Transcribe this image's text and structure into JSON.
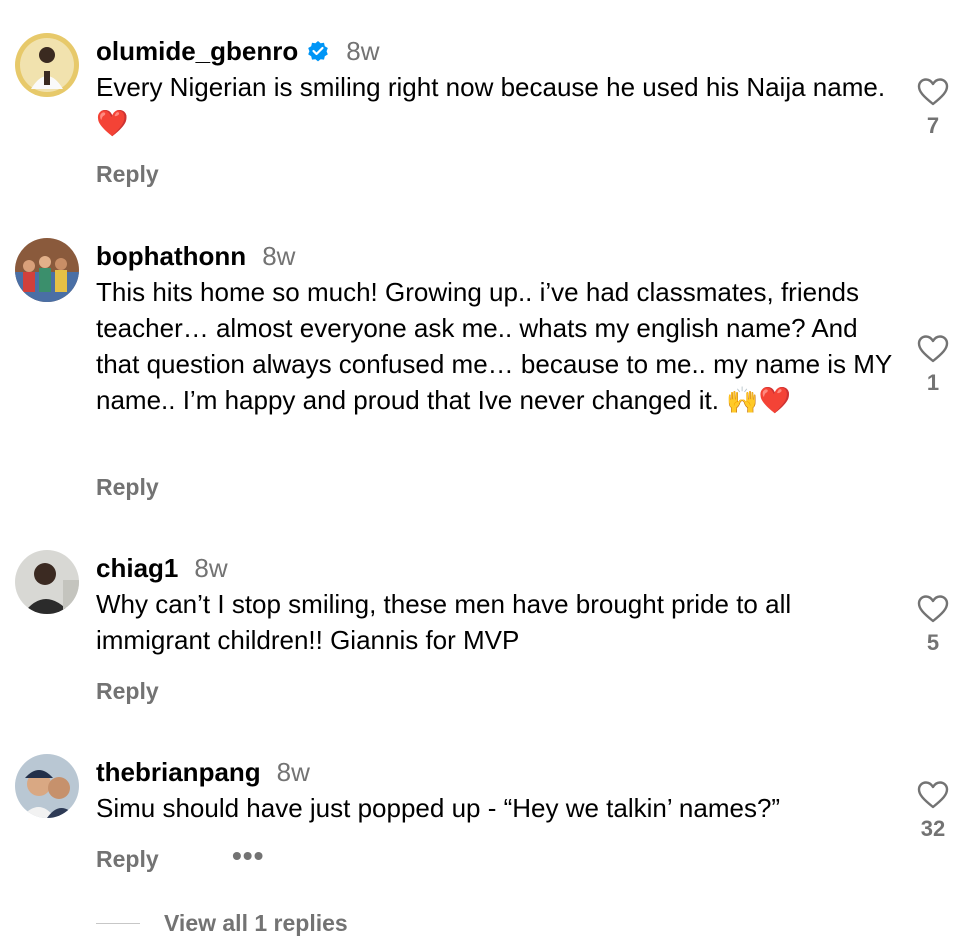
{
  "comments": [
    {
      "username": "olumide_gbenro",
      "verified": true,
      "time": "8w",
      "text": "Every Nigerian is smiling right now because he used his Naija name. ",
      "emoji": "❤️",
      "likes": "7",
      "reply_label": "Reply"
    },
    {
      "username": "bophathonn",
      "verified": false,
      "time": "8w",
      "text": "This hits home so much! Growing up.. i’ve had classmates, friends teacher… almost everyone ask me.. whats my english name? And that question always confused me… because to me.. my name is MY name.. I’m happy and proud that Ive never changed it. ",
      "emoji": "🙌❤️",
      "likes": "1",
      "reply_label": "Reply"
    },
    {
      "username": "chiag1",
      "verified": false,
      "time": "8w",
      "text": "Why can’t I stop smiling, these men have brought pride to all immigrant children!! Giannis for MVP",
      "emoji": "",
      "likes": "5",
      "reply_label": "Reply"
    },
    {
      "username": "thebrianpang",
      "verified": false,
      "time": "8w",
      "text": "Simu should have just popped up - “Hey we talkin’ names?”",
      "emoji": "",
      "likes": "32",
      "reply_label": "Reply"
    }
  ],
  "more_options": "•••",
  "view_replies": "View all 1 replies",
  "icons": {
    "verified": "verified-badge-icon",
    "like": "heart-outline-icon",
    "more": "more-options-icon"
  },
  "colors": {
    "text": "#000000",
    "muted": "#737373",
    "verified": "#0095F6"
  }
}
